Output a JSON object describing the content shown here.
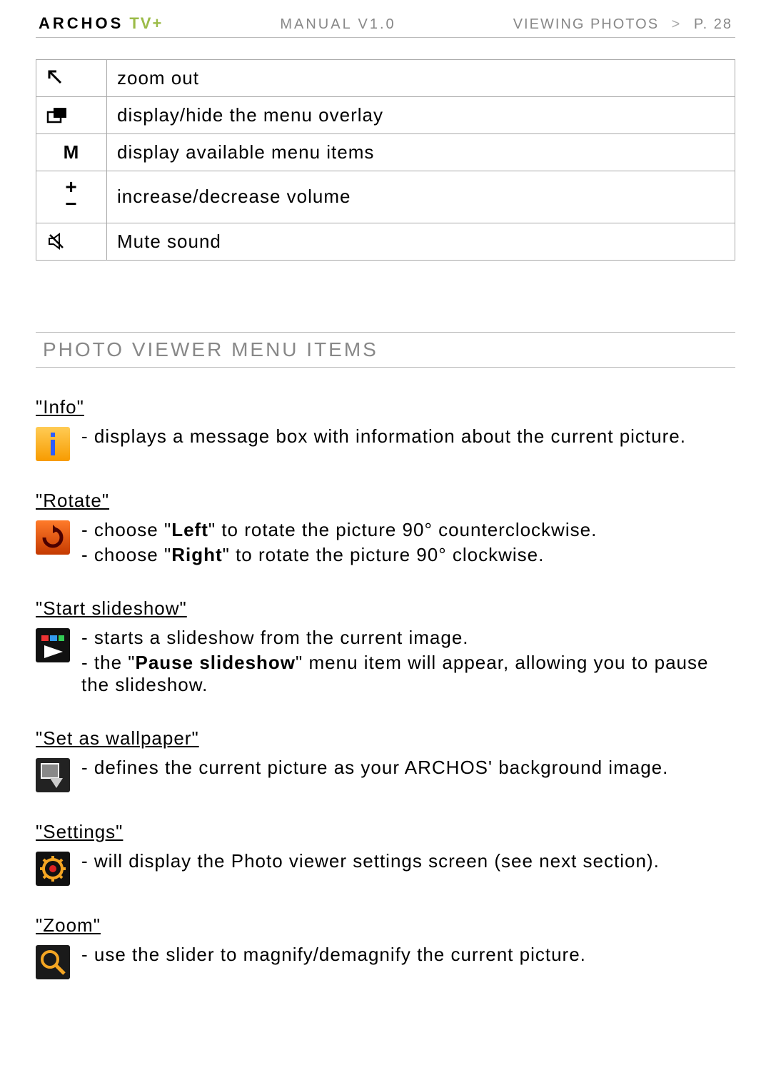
{
  "header": {
    "brand": "ARCHOS",
    "product": "TV+",
    "manual": "MANUAL V1.0",
    "section": "VIEWING PHOTOS",
    "sep": ">",
    "page": "P. 28"
  },
  "controls": [
    {
      "icon": "zoom-out-icon",
      "glyph": "svg",
      "label": "zoom out"
    },
    {
      "icon": "overlay-icon",
      "glyph": "svg",
      "label": "display/hide the menu overlay"
    },
    {
      "icon": "menu-letter",
      "glyph": "M",
      "label": "display available menu items"
    },
    {
      "icon": "volume-plusminus",
      "glyph": "pm",
      "label": "increase/decrease volume"
    },
    {
      "icon": "mute-icon",
      "glyph": "svg",
      "label": "Mute sound"
    }
  ],
  "section_title": "PHOTO VIEWER MENU ITEMS",
  "menu_items": {
    "info": {
      "title": "\"Info\"",
      "lines": [
        {
          "segments": [
            {
              "text": "displays a message box with information about the current picture."
            }
          ]
        }
      ]
    },
    "rotate": {
      "title": "\"Rotate\"",
      "lines": [
        {
          "segments": [
            {
              "text": "choose \""
            },
            {
              "text": "Left",
              "bold": true
            },
            {
              "text": "\" to rotate the picture 90° counterclockwise."
            }
          ]
        },
        {
          "segments": [
            {
              "text": "choose \""
            },
            {
              "text": "Right",
              "bold": true
            },
            {
              "text": "\" to rotate the picture 90° clockwise."
            }
          ]
        }
      ]
    },
    "slideshow": {
      "title": "\"Start slideshow\"",
      "lines": [
        {
          "segments": [
            {
              "text": "starts a slideshow from the current image."
            }
          ]
        },
        {
          "segments": [
            {
              "text": "the \""
            },
            {
              "text": "Pause slideshow",
              "bold": true
            },
            {
              "text": "\" menu item will appear, allowing you to pause the slideshow."
            }
          ]
        }
      ]
    },
    "wallpaper": {
      "title": "\"Set as wallpaper\"",
      "lines": [
        {
          "segments": [
            {
              "text": "defines the current picture as your ARCHOS' background image."
            }
          ]
        }
      ]
    },
    "settings": {
      "title": "\"Settings\"",
      "lines": [
        {
          "segments": [
            {
              "text": "will display the Photo viewer settings screen (see next section)."
            }
          ]
        }
      ]
    },
    "zoom": {
      "title": "\"Zoom\"",
      "lines": [
        {
          "segments": [
            {
              "text": "use the slider to magnify/demagnify the current picture."
            }
          ]
        }
      ]
    }
  }
}
